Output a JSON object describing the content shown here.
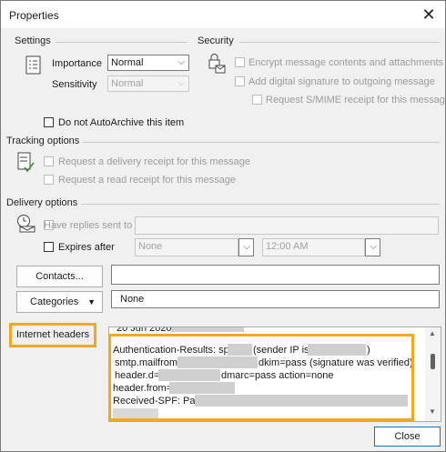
{
  "window": {
    "title": "Properties"
  },
  "settings": {
    "section_label": "Settings",
    "importance_label": "Importance",
    "importance_value": "Normal",
    "sensitivity_label": "Sensitivity",
    "sensitivity_value": "Normal",
    "autoarchive_label": "Do not AutoArchive this item"
  },
  "security": {
    "section_label": "Security",
    "encrypt_label": "Encrypt message contents and attachments",
    "signature_label": "Add digital signature to outgoing message",
    "smime_label": "Request S/MIME receipt for this message"
  },
  "tracking": {
    "section_label": "Tracking options",
    "delivery_receipt_label": "Request a delivery receipt for this message",
    "read_receipt_label": "Request a read receipt for this message"
  },
  "delivery": {
    "section_label": "Delivery options",
    "replies_label": "Have replies sent to",
    "replies_value": "",
    "expires_label": "Expires after",
    "expires_date": "None",
    "expires_time": "12:00 AM"
  },
  "contacts": {
    "button_label": "Contacts...",
    "value": ""
  },
  "categories": {
    "button_label": "Categories",
    "value": "None"
  },
  "headers": {
    "label": "Internet headers",
    "lines": [
      "20 Jun 2020",
      "Authentication-Results: spf",
      "(sender IP is",
      ")",
      "smtp.mailfrom",
      "dkim=pass (signature was verified)",
      "header.d=",
      "dmarc=pass action=none",
      "header.from=",
      "Received-SPF: Pass"
    ]
  },
  "footer": {
    "close_label": "Close"
  },
  "colors": {
    "highlight": "#f5a623"
  }
}
